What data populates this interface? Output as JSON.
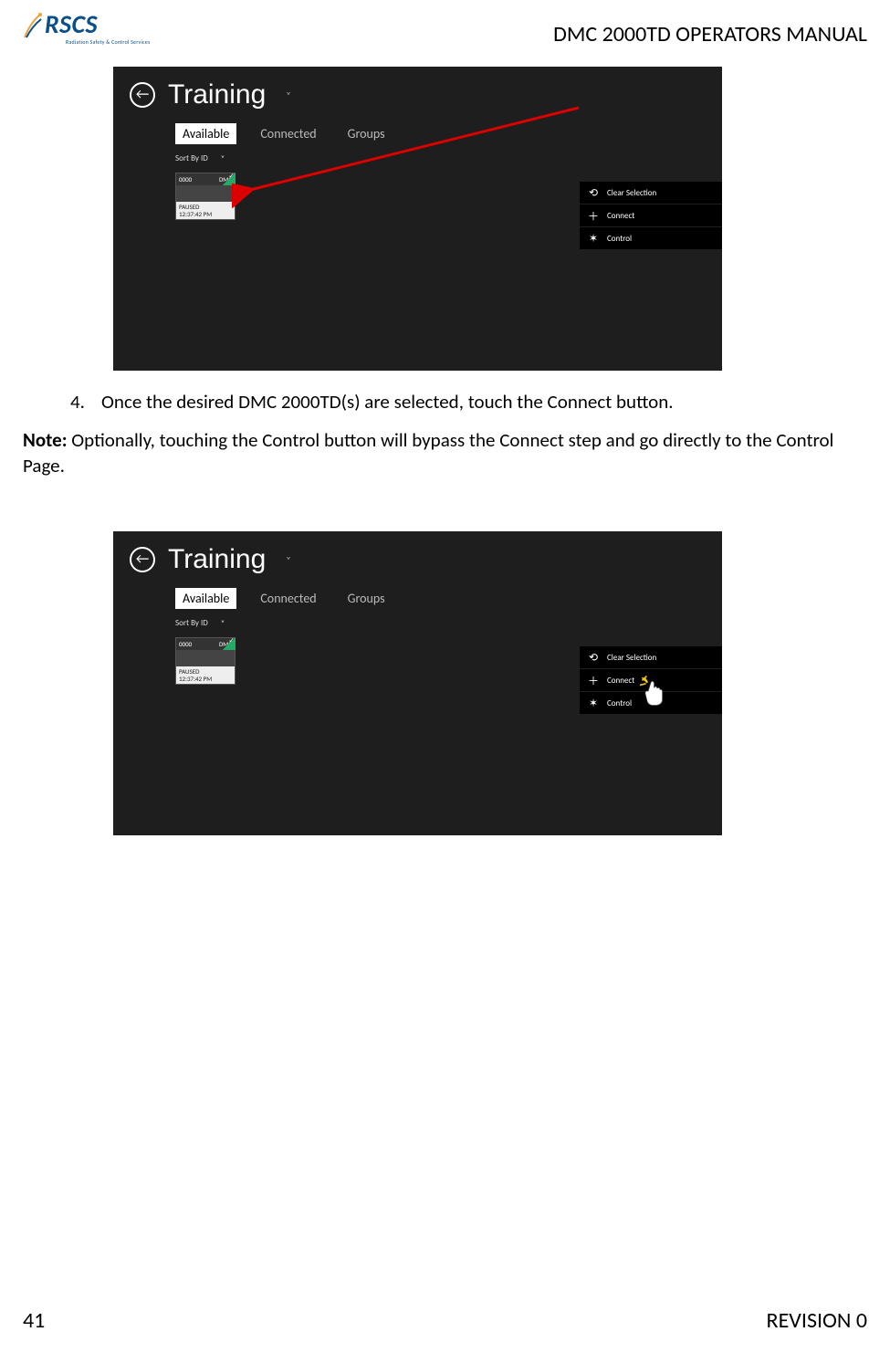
{
  "header": {
    "logo_text": "RSCS",
    "logo_sub": "Radiation Safety & Control Services",
    "doc_title": "DMC 2000TD OPERATORS MANUAL"
  },
  "footer": {
    "page_num": "41",
    "revision": "REVISION 0"
  },
  "body": {
    "step_num": "4.",
    "step_text": "Once the desired DMC 2000TD(s) are selected, touch the Connect button.",
    "note_label": "Note:",
    "note_text": " Optionally, touching the Control button will bypass the Connect step and go directly to the Control Page."
  },
  "shot": {
    "back_glyph": "←",
    "title": "Training",
    "chev": "˅",
    "tabs": {
      "available": "Available",
      "connected": "Connected",
      "groups": "Groups"
    },
    "sort_label": "Sort By ID",
    "sort_chev": "˅",
    "tile": {
      "id": "0000",
      "name": "DMC",
      "status": "PAUSED",
      "time": "12:37:42 PM"
    },
    "menu": {
      "clear": "Clear Selection",
      "connect": "Connect",
      "control": "Control",
      "clear_glyph": "⟲",
      "connect_glyph": "＋",
      "control_glyph": "✶"
    }
  }
}
